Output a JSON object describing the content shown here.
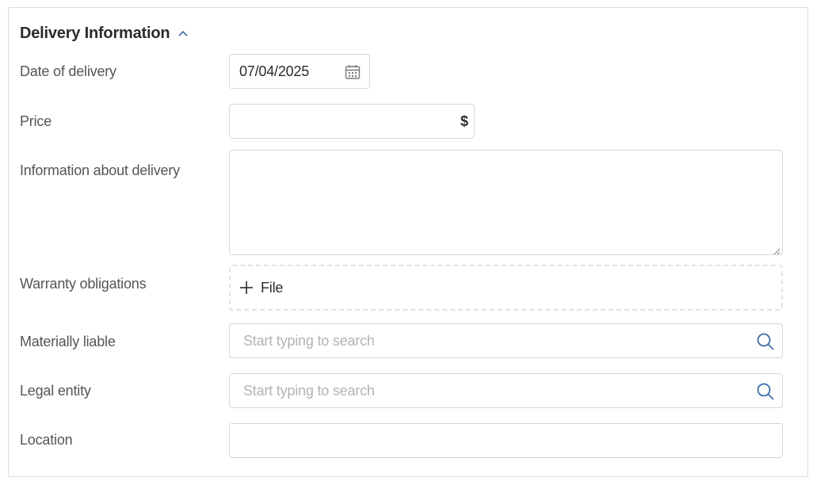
{
  "section": {
    "title": "Delivery Information",
    "expanded": true
  },
  "fields": {
    "date_of_delivery": {
      "label": "Date of delivery",
      "value": "07/04/2025"
    },
    "price": {
      "label": "Price",
      "value": "",
      "currency": "$"
    },
    "information_about_delivery": {
      "label": "Information about delivery",
      "value": ""
    },
    "warranty_obligations": {
      "label": "Warranty obligations",
      "button_label": "File"
    },
    "materially_liable": {
      "label": "Materially liable",
      "placeholder": "Start typing to search",
      "value": ""
    },
    "legal_entity": {
      "label": "Legal entity",
      "placeholder": "Start typing to search",
      "value": ""
    },
    "location": {
      "label": "Location",
      "value": ""
    }
  },
  "icons": {
    "collapse": "chevron-up-icon",
    "calendar": "calendar-icon",
    "add": "plus-icon",
    "search": "search-icon"
  },
  "colors": {
    "accent": "#3d6fa8",
    "border": "#d6d6d6",
    "label": "#555555",
    "placeholder": "#b3b3b3"
  }
}
